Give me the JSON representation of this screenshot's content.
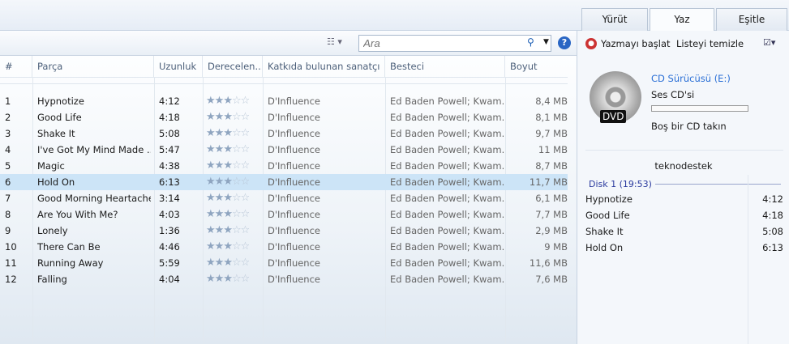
{
  "tabs": [
    {
      "label": "Yürüt"
    },
    {
      "label": "Yaz"
    },
    {
      "label": "Eşitle"
    }
  ],
  "search": {
    "placeholder": "Ara"
  },
  "columns": [
    "#",
    "Parça",
    "Uzunluk",
    "Derecelen...",
    "Katkıda bulunan sanatçı",
    "Besteci",
    "Boyut"
  ],
  "tracks": [
    {
      "n": "1",
      "title": "Hypnotize",
      "len": "4:12",
      "rating": 3,
      "artist": "D'Influence",
      "composer": "Ed Baden Powell; Kwam...",
      "size": "8,4 MB"
    },
    {
      "n": "2",
      "title": "Good Life",
      "len": "4:18",
      "rating": 3,
      "artist": "D'Influence",
      "composer": "Ed Baden Powell; Kwam...",
      "size": "8,1 MB"
    },
    {
      "n": "3",
      "title": "Shake It",
      "len": "5:08",
      "rating": 3,
      "artist": "D'Influence",
      "composer": "Ed Baden Powell; Kwam...",
      "size": "9,7 MB"
    },
    {
      "n": "4",
      "title": "I've Got My Mind Made ...",
      "len": "5:47",
      "rating": 3,
      "artist": "D'Influence",
      "composer": "Ed Baden Powell; Kwam...",
      "size": "11 MB"
    },
    {
      "n": "5",
      "title": "Magic",
      "len": "4:38",
      "rating": 3,
      "artist": "D'Influence",
      "composer": "Ed Baden Powell; Kwam...",
      "size": "8,7 MB"
    },
    {
      "n": "6",
      "title": "Hold On",
      "len": "6:13",
      "rating": 3,
      "artist": "D'Influence",
      "composer": "Ed Baden Powell; Kwam...",
      "size": "11,7 MB"
    },
    {
      "n": "7",
      "title": "Good Morning Heartache",
      "len": "3:14",
      "rating": 3,
      "artist": "D'Influence",
      "composer": "Ed Baden Powell; Kwam...",
      "size": "6,1 MB"
    },
    {
      "n": "8",
      "title": "Are You With Me?",
      "len": "4:03",
      "rating": 3,
      "artist": "D'Influence",
      "composer": "Ed Baden Powell; Kwam...",
      "size": "7,7 MB"
    },
    {
      "n": "9",
      "title": "Lonely",
      "len": "1:36",
      "rating": 3,
      "artist": "D'Influence",
      "composer": "Ed Baden Powell; Kwam...",
      "size": "2,9 MB"
    },
    {
      "n": "10",
      "title": "There Can Be",
      "len": "4:46",
      "rating": 3,
      "artist": "D'Influence",
      "composer": "Ed Baden Powell; Kwam...",
      "size": "9 MB"
    },
    {
      "n": "11",
      "title": "Running Away",
      "len": "5:59",
      "rating": 3,
      "artist": "D'Influence",
      "composer": "Ed Baden Powell; Kwam...",
      "size": "11,6 MB"
    },
    {
      "n": "12",
      "title": "Falling",
      "len": "4:04",
      "rating": 3,
      "artist": "D'Influence",
      "composer": "Ed Baden Powell; Kwam...",
      "size": "7,6 MB"
    }
  ],
  "selected_index": 5,
  "burn": {
    "start_label": "Yazmayı başlat",
    "clear_label": "Listeyi temizle",
    "drive": "CD Sürücüsü (E:)",
    "disc_type": "Ses CD'si",
    "progress": 0,
    "status": "Boş bir CD takın",
    "disc_label": "DVD",
    "list_title": "teknodestek",
    "disk_header": "Disk 1 (19:53)",
    "items": [
      {
        "title": "Hypnotize",
        "len": "4:12"
      },
      {
        "title": "Good Life",
        "len": "4:18"
      },
      {
        "title": "Shake It",
        "len": "5:08"
      },
      {
        "title": "Hold On",
        "len": "6:13"
      }
    ]
  }
}
